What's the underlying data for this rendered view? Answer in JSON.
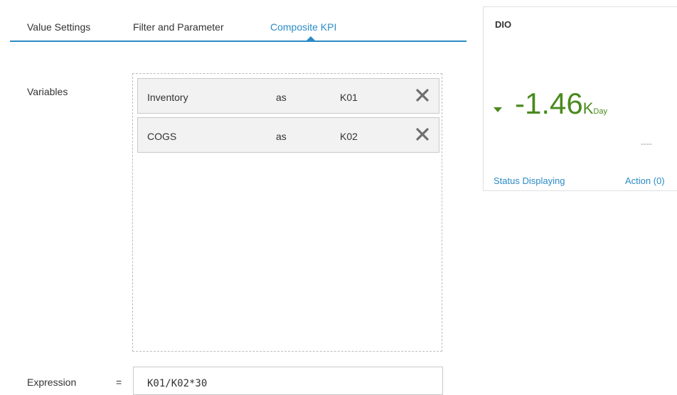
{
  "tabs": [
    {
      "label": "Value Settings"
    },
    {
      "label": "Filter and Parameter"
    },
    {
      "label": "Composite KPI",
      "active": true
    }
  ],
  "variables": {
    "label": "Variables",
    "rows": [
      {
        "name": "Inventory",
        "as": "as",
        "alias": "K01"
      },
      {
        "name": "COGS",
        "as": "as",
        "alias": "K02"
      }
    ]
  },
  "expression": {
    "label": "Expression",
    "equals": "=",
    "value": "K01/K02*30"
  },
  "kpi": {
    "title": "DIO",
    "value": "-1.46",
    "unit_scale": "K",
    "unit": "Day",
    "trend": "down",
    "secondary": "----",
    "status_link": "Status Displaying",
    "action_link": "Action (0)",
    "value_color": "#4a8a1e"
  },
  "colors": {
    "accent": "#2b8bc6",
    "kpi_value": "#4a8a1e"
  },
  "icons": {
    "remove": "close-icon",
    "trend": "triangle-down-icon"
  }
}
